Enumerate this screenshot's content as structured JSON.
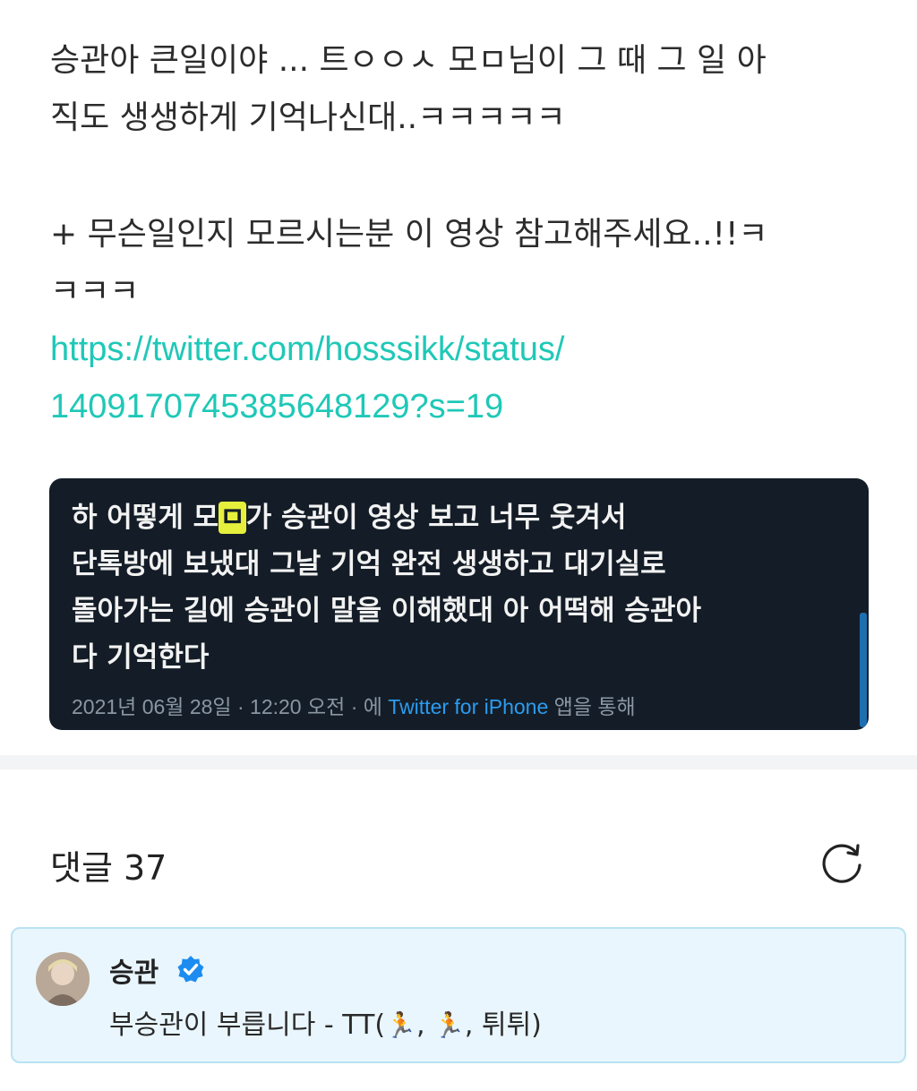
{
  "post": {
    "line1": "승관아 큰일이야 ... 트ㅇㅇㅅ 모ㅁ님이 그 때 그 일 아",
    "line2": "직도 생생하게 기억나신대..ㅋㅋㅋㅋㅋ",
    "line3": "+ 무슨일인지 모르시는분 이 영상 참고해주세요..!!ㅋ",
    "line4": "ㅋㅋㅋ",
    "link_line1": "https://twitter.com/hosssikk/status/",
    "link_line2": "1409170745385648129?s=19"
  },
  "embed": {
    "line1_a": "하 어떻게 모",
    "line1_highlight": "ㅁ",
    "line1_b": "가 승관이 영상 보고 너무 웃겨서",
    "line2": "단톡방에 보냈대 그날 기억 완전 생생하고 대기실로",
    "line3": "돌아가는 길에 승관이 말을 이해했대 아 어떡해 승관아",
    "line4": "다 기억한다",
    "meta_prefix": "2021년 06월 28일 · 12:20 오전 · 에 ",
    "meta_app": "Twitter for iPhone",
    "meta_suffix": " 앱을 통해"
  },
  "comments": {
    "title": "댓글 37",
    "items": [
      {
        "author": "승관",
        "text_a": "부승관이 부릅니다 - TT(",
        "emoji1": "🏃",
        "text_b": ", ",
        "emoji2": "🏃",
        "text_c": ", 튀튀)"
      }
    ]
  },
  "colors": {
    "link": "#1fc8b7",
    "embed_bg": "#141d27",
    "comment_bg": "#e9f6fd",
    "verified": "#1d8cf0"
  },
  "icons": {
    "refresh": "refresh-icon",
    "verified": "verified-badge-icon"
  }
}
